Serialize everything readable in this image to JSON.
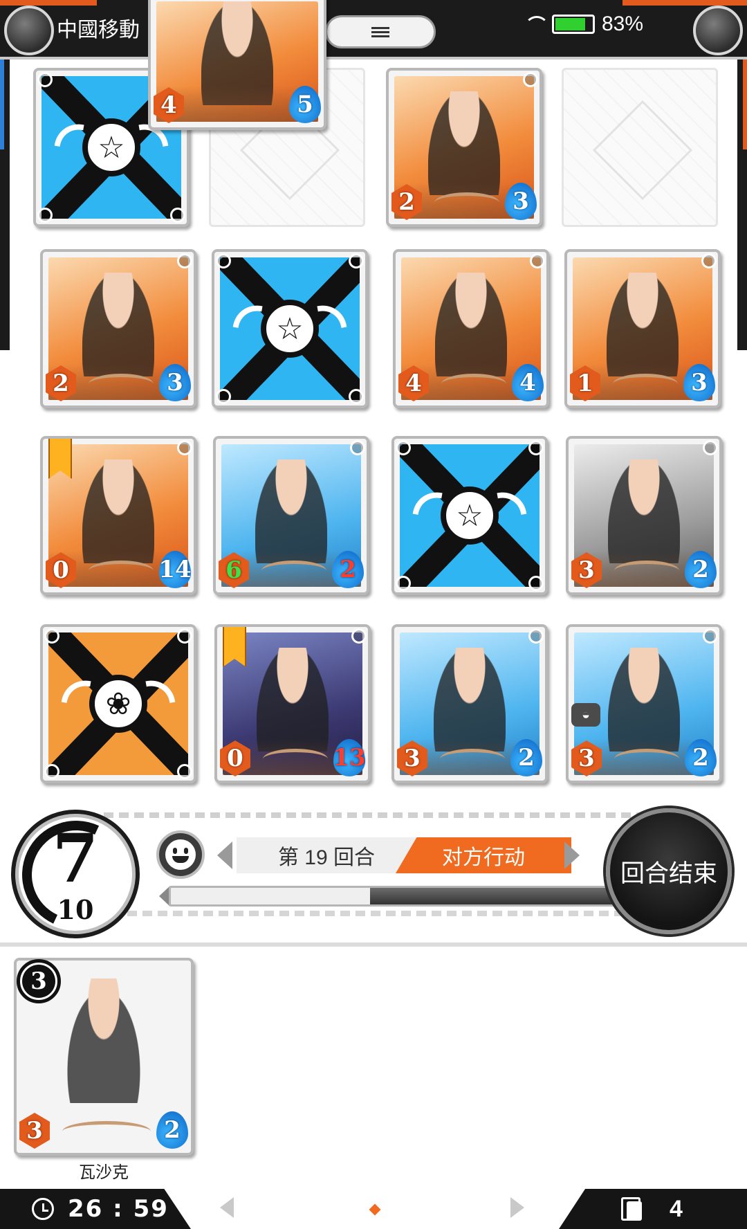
{
  "status_bar": {
    "carrier": "中國移動",
    "battery": "83%",
    "battery_level": 0.83,
    "top_left_badge": "",
    "top_right_badge": ""
  },
  "board": {
    "dragged_card": {
      "attack": "4",
      "health": "5",
      "art": "orange"
    },
    "cards": [
      {
        "slot": "r1c1",
        "face_down": true,
        "back": "blue"
      },
      {
        "slot": "r1c2",
        "empty": true
      },
      {
        "slot": "r1c3",
        "attack": "2",
        "health": "3",
        "art": "orange"
      },
      {
        "slot": "r1c4",
        "empty": true
      },
      {
        "slot": "r2c1",
        "attack": "2",
        "health": "3",
        "art": "orange"
      },
      {
        "slot": "r2c2",
        "face_down": true,
        "back": "blue"
      },
      {
        "slot": "r2c3",
        "attack": "4",
        "health": "4",
        "art": "orange"
      },
      {
        "slot": "r2c4",
        "attack": "1",
        "health": "3",
        "art": "orange"
      },
      {
        "slot": "r3c1",
        "attack": "0",
        "health": "14",
        "art": "orange",
        "rank_flag": true
      },
      {
        "slot": "r3c2",
        "attack": "6",
        "health": "2",
        "art": "blue",
        "attack_color": "green",
        "health_color": "red"
      },
      {
        "slot": "r3c3",
        "face_down": true,
        "back": "blue"
      },
      {
        "slot": "r3c4",
        "attack": "3",
        "health": "2",
        "art": "grey"
      },
      {
        "slot": "r4c1",
        "face_down": true,
        "back": "orange"
      },
      {
        "slot": "r4c2",
        "attack": "0",
        "health": "13",
        "art": "purple",
        "rank_flag": true,
        "health_color": "red"
      },
      {
        "slot": "r4c3",
        "attack": "3",
        "health": "2",
        "art": "blue"
      },
      {
        "slot": "r4c4",
        "attack": "3",
        "health": "2",
        "art": "blue",
        "mask_badge": true
      }
    ]
  },
  "controls": {
    "mana_current": "7",
    "mana_max": "10",
    "turn_label": "第 19 回合",
    "turn_state": "对方行动",
    "end_turn": "回合结束",
    "timer_remaining_fraction": 0.55
  },
  "hand": {
    "card": {
      "cost": "3",
      "attack": "3",
      "health": "2",
      "name": "瓦沙克",
      "art": "blue"
    }
  },
  "bottom_bar": {
    "clock": "26 : 59",
    "deck_count": "4"
  },
  "colors": {
    "accent": "#f06a1f",
    "dark": "#151515",
    "card_blue": "#2fb6f2",
    "card_orange": "#f39a3a"
  }
}
